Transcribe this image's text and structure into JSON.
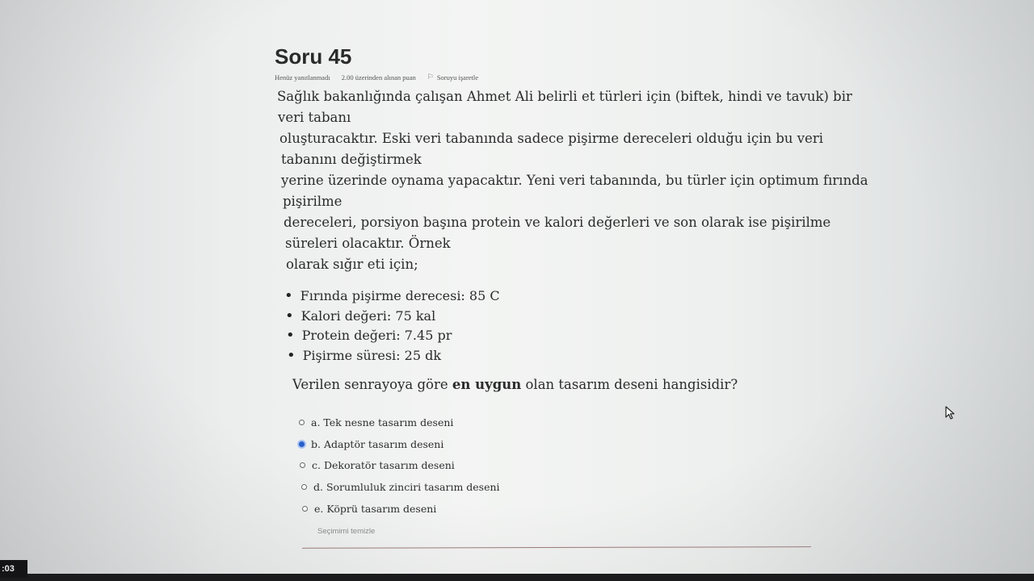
{
  "question": {
    "title": "Soru 45",
    "status": "Henüz yanıtlanmadı",
    "points": "2.00 üzerinden alınan puan",
    "flag_label": "Soruyu işaretle",
    "flag_icon": "flag-icon",
    "text_lines": [
      "Sağlık bakanlığında çalışan Ahmet Ali belirli et türleri için (biftek, hindi ve tavuk) bir",
      "veri tabanı",
      "oluşturacaktır. Eski veri tabanında sadece pişirme dereceleri olduğu için bu veri",
      "tabanını değiştirmek",
      "yerine üzerinde oynama yapacaktır. Yeni veri tabanında, bu türler için optimum fırında",
      "pişirilme",
      "dereceleri, porsiyon başına protein ve kalori değerleri ve son olarak ise pişirilme",
      "süreleri olacaktır. Örnek",
      "olarak sığır eti için;"
    ],
    "facts": [
      "Fırında pişirme derecesi: 85 C",
      "Kalori değeri: 75 kal",
      "Protein değeri: 7.45 pr",
      "Pişirme süresi: 25 dk"
    ],
    "prompt_before": "Verilen senrayoya göre ",
    "prompt_bold": "en uygun",
    "prompt_after": " olan tasarım deseni hangisidir?",
    "answers": [
      {
        "label": "a. Tek nesne tasarım deseni",
        "selected": false
      },
      {
        "label": "b. Adaptör tasarım deseni",
        "selected": true
      },
      {
        "label": "c. Dekoratör tasarım deseni",
        "selected": false
      },
      {
        "label": "d. Sorumluluk zinciri tasarım deseni",
        "selected": false
      },
      {
        "label": "e. Köprü tasarım deseni",
        "selected": false
      }
    ],
    "clear_label": "Seçimimi temizle"
  },
  "taskbar": {
    "clock": ":03"
  },
  "colors": {
    "selected_radio": "#2a5fc9",
    "text": "#2b2b2b"
  }
}
